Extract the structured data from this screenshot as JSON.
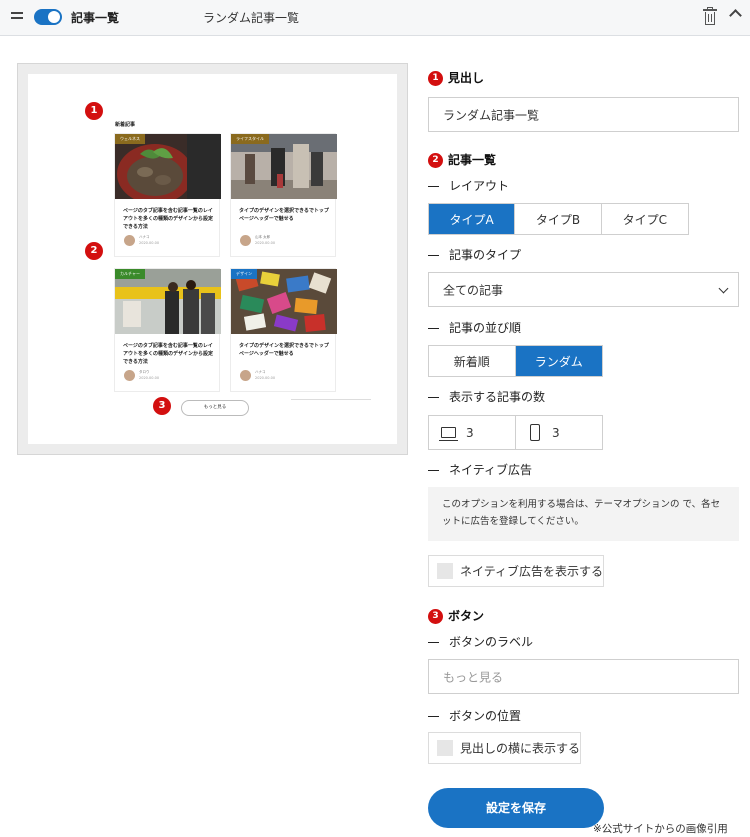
{
  "header": {
    "title": "記事一覧",
    "subtitle": "ランダム記事一覧"
  },
  "preview": {
    "heading": "新着記事",
    "cards": [
      {
        "tag": "ウェルネス",
        "tag_color": "#8a6a1e",
        "title": "ページのタブ記事を含む記事一覧のレイアウトを多くの種類のデザインから設定できる方法",
        "author": "ハナコ",
        "date": "2020.00.00"
      },
      {
        "tag": "ライフスタイル",
        "tag_color": "#8a6a1e",
        "title": "タイプのデザインを選択できるでトップページヘッダーで魅せる",
        "author": "山本 太郎",
        "date": "2020.00.00"
      },
      {
        "tag": "カルチャー",
        "tag_color": "#3a8a2a",
        "title": "ページのタブ記事を含む記事一覧のレイアウトを多くの種類のデザインから設定できる方法",
        "author": "タロウ",
        "date": "2020.00.00"
      },
      {
        "tag": "デザイン",
        "tag_color": "#1a73c4",
        "title": "タイプのデザインを選択できるでトップページヘッダーで魅せる",
        "author": "ハナコ",
        "date": "2020.00.00"
      }
    ],
    "more_label": "もっと見る",
    "markers": [
      "1",
      "2",
      "3"
    ]
  },
  "settings": {
    "heading_section": {
      "num": "1",
      "title": "見出し",
      "value": "ランダム記事一覧"
    },
    "list_section": {
      "num": "2",
      "title": "記事一覧",
      "layout_label": "レイアウト",
      "layout_options": [
        "タイプA",
        "タイプB",
        "タイプC"
      ],
      "layout_selected": "タイプA",
      "type_label": "記事のタイプ",
      "type_value": "全ての記事",
      "order_label": "記事の並び順",
      "order_options": [
        "新着順",
        "ランダム"
      ],
      "order_selected": "ランダム",
      "count_label": "表示する記事の数",
      "count_pc": "3",
      "count_sp": "3",
      "ad_label": "ネイティブ広告",
      "ad_info": "このオプションを利用する場合は、テーマオプションの で、各セットに広告を登録してください。",
      "ad_checkbox": "ネイティブ広告を表示する"
    },
    "button_section": {
      "num": "3",
      "title": "ボタン",
      "label_label": "ボタンのラベル",
      "label_placeholder": "もっと見る",
      "position_label": "ボタンの位置",
      "position_checkbox": "見出しの横に表示する"
    },
    "save_label": "設定を保存"
  },
  "credit": "※公式サイトからの画像引用",
  "colors": {
    "accent": "#1a73c4",
    "marker": "#d30f0f"
  }
}
